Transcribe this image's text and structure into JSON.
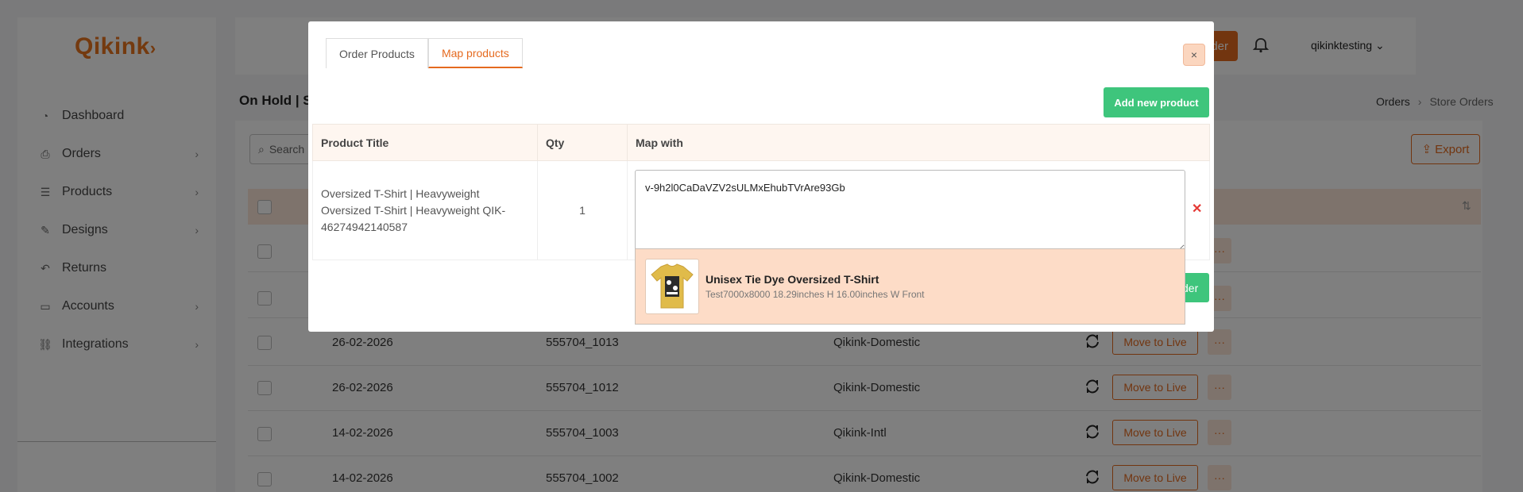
{
  "app": {
    "logo_text": "Qikink",
    "logo_suffix": "›"
  },
  "sidebar": {
    "items": [
      {
        "label": "Dashboard",
        "icon": "gauge-icon",
        "has_submenu": false
      },
      {
        "label": "Orders",
        "icon": "printer-icon",
        "has_submenu": true
      },
      {
        "label": "Products",
        "icon": "list-icon",
        "has_submenu": true
      },
      {
        "label": "Designs",
        "icon": "pencil-icon",
        "has_submenu": true
      },
      {
        "label": "Returns",
        "icon": "return-icon",
        "has_submenu": false
      },
      {
        "label": "Accounts",
        "icon": "folder-icon",
        "has_submenu": true
      },
      {
        "label": "Integrations",
        "icon": "link-icon",
        "has_submenu": true
      }
    ]
  },
  "header": {
    "create_button_label": "der",
    "user_name": "qikinktesting",
    "user_caret": "⌄"
  },
  "page": {
    "title": "On Hold | St",
    "breadcrumb": {
      "parent": "Orders",
      "separator": "›",
      "current": "Store Orders"
    },
    "search_placeholder": "Search",
    "export_label": "Export",
    "sort_glyph": "⇅"
  },
  "orders_table": {
    "rows": [
      {
        "date": "26-02-2026",
        "order_id": "555704_1013",
        "type": "Qikink-Domestic",
        "action_label": "Move to Live",
        "more_label": "···"
      },
      {
        "date": "26-02-2026",
        "order_id": "555704_1012",
        "type": "Qikink-Domestic",
        "action_label": "Move to Live",
        "more_label": "···"
      },
      {
        "date": "14-02-2026",
        "order_id": "555704_1003",
        "type": "Qikink-Intl",
        "action_label": "Move to Live",
        "more_label": "···"
      },
      {
        "date": "14-02-2026",
        "order_id": "555704_1002",
        "type": "Qikink-Domestic",
        "action_label": "Move to Live",
        "more_label": "···"
      }
    ],
    "more_label": "···"
  },
  "modal": {
    "tabs": [
      {
        "label": "Order Products",
        "active": false
      },
      {
        "label": "Map products",
        "active": true
      }
    ],
    "close_label": "×",
    "add_new_product_label": "Add new product",
    "table": {
      "headers": [
        "Product Title",
        "Qty",
        "Map with"
      ],
      "row": {
        "product_title": "Oversized T-Shirt | Heavyweight Oversized T-Shirt | Heavyweight QIK-46274942140587",
        "qty": "1",
        "map_with_value": "v-9h2l0CaDaVZV2sULMxEhubTVrAre93Gb"
      }
    },
    "remove_label": "✕",
    "suggestion": {
      "name": "Unisex Tie Dye Oversized T-Shirt",
      "meta": "Test7000x8000 18.29inches H 16.00inches W Front"
    },
    "save_button_peek": "der"
  },
  "colors": {
    "accent": "#e56a1f",
    "success": "#3ec57c",
    "danger": "#e53935",
    "highlight": "#fddcc7"
  }
}
